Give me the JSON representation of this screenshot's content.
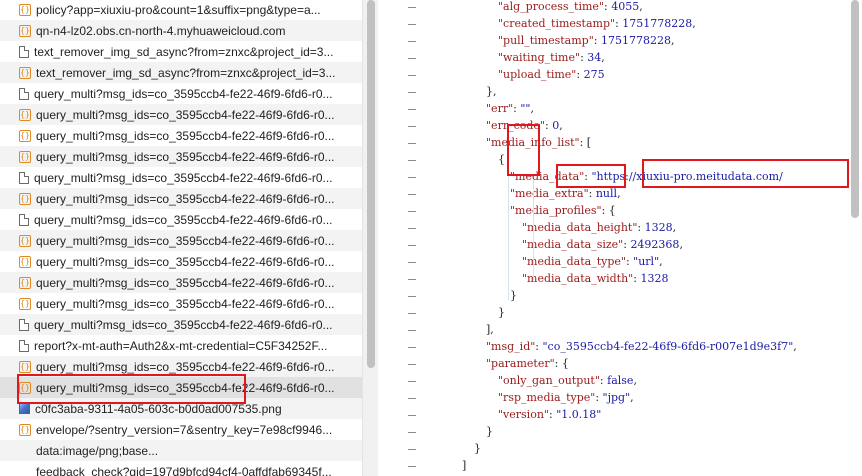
{
  "requests": [
    {
      "icon": "xhr",
      "name": "policy?app=xiuxiu-pro&count=1&suffix=png&type=a..."
    },
    {
      "icon": "xhr",
      "name": "qn-n4-lz02.obs.cn-north-4.myhuaweicloud.com"
    },
    {
      "icon": "doc",
      "name": "text_remover_img_sd_async?from=znxc&project_id=3..."
    },
    {
      "icon": "xhr",
      "name": "text_remover_img_sd_async?from=znxc&project_id=3..."
    },
    {
      "icon": "doc",
      "name": "query_multi?msg_ids=co_3595ccb4-fe22-46f9-6fd6-r0..."
    },
    {
      "icon": "xhr",
      "name": "query_multi?msg_ids=co_3595ccb4-fe22-46f9-6fd6-r0..."
    },
    {
      "icon": "xhr",
      "name": "query_multi?msg_ids=co_3595ccb4-fe22-46f9-6fd6-r0..."
    },
    {
      "icon": "xhr",
      "name": "query_multi?msg_ids=co_3595ccb4-fe22-46f9-6fd6-r0..."
    },
    {
      "icon": "doc",
      "name": "query_multi?msg_ids=co_3595ccb4-fe22-46f9-6fd6-r0..."
    },
    {
      "icon": "xhr",
      "name": "query_multi?msg_ids=co_3595ccb4-fe22-46f9-6fd6-r0..."
    },
    {
      "icon": "doc",
      "name": "query_multi?msg_ids=co_3595ccb4-fe22-46f9-6fd6-r0..."
    },
    {
      "icon": "xhr",
      "name": "query_multi?msg_ids=co_3595ccb4-fe22-46f9-6fd6-r0..."
    },
    {
      "icon": "xhr",
      "name": "query_multi?msg_ids=co_3595ccb4-fe22-46f9-6fd6-r0..."
    },
    {
      "icon": "xhr",
      "name": "query_multi?msg_ids=co_3595ccb4-fe22-46f9-6fd6-r0..."
    },
    {
      "icon": "xhr",
      "name": "query_multi?msg_ids=co_3595ccb4-fe22-46f9-6fd6-r0..."
    },
    {
      "icon": "doc",
      "name": "query_multi?msg_ids=co_3595ccb4-fe22-46f9-6fd6-r0..."
    },
    {
      "icon": "doc",
      "name": "report?x-mt-auth=Auth2&x-mt-credential=C5F34252F..."
    },
    {
      "icon": "xhr",
      "name": "query_multi?msg_ids=co_3595ccb4-fe22-46f9-6fd6-r0..."
    },
    {
      "icon": "xhr",
      "name": "query_multi?msg_ids=co_3595ccb4-fe22-46f9-6fd6-r0...",
      "selected": true
    },
    {
      "icon": "img",
      "name": "c0fc3aba-9311-4a05-603c-b0d0ad007535.png"
    },
    {
      "icon": "xhr",
      "name": "envelope/?sentry_version=7&sentry_key=7e98cf9946..."
    },
    {
      "icon": "blank",
      "name": "data:image/png;base..."
    },
    {
      "icon": "blank",
      "name": "feedback_check?gid=197d9bfcd94cf4-0affdfab69345f..."
    }
  ],
  "json_lines": [
    {
      "indent": 7,
      "parts": [
        [
          "k",
          "\"alg_process_time\""
        ],
        [
          "p",
          ": "
        ],
        [
          "n",
          "4055"
        ],
        [
          "p",
          ","
        ]
      ]
    },
    {
      "indent": 7,
      "parts": [
        [
          "k",
          "\"created_timestamp\""
        ],
        [
          "p",
          ": "
        ],
        [
          "n",
          "1751778228"
        ],
        [
          "p",
          ","
        ]
      ]
    },
    {
      "indent": 7,
      "parts": [
        [
          "k",
          "\"pull_timestamp\""
        ],
        [
          "p",
          ": "
        ],
        [
          "n",
          "1751778228"
        ],
        [
          "p",
          ","
        ]
      ]
    },
    {
      "indent": 7,
      "parts": [
        [
          "k",
          "\"waiting_time\""
        ],
        [
          "p",
          ": "
        ],
        [
          "n",
          "34"
        ],
        [
          "p",
          ","
        ]
      ]
    },
    {
      "indent": 7,
      "parts": [
        [
          "k",
          "\"upload_time\""
        ],
        [
          "p",
          ": "
        ],
        [
          "n",
          "275"
        ]
      ]
    },
    {
      "indent": 6,
      "parts": [
        [
          "p",
          "},"
        ]
      ]
    },
    {
      "indent": 6,
      "parts": [
        [
          "k",
          "\"err\""
        ],
        [
          "p",
          ": "
        ],
        [
          "s",
          "\"\""
        ],
        [
          "p",
          ","
        ]
      ]
    },
    {
      "indent": 6,
      "parts": [
        [
          "k",
          "\"err_code\""
        ],
        [
          "p",
          ": "
        ],
        [
          "n",
          "0"
        ],
        [
          "p",
          ","
        ]
      ]
    },
    {
      "indent": 6,
      "parts": [
        [
          "k",
          "\"media_info_list\""
        ],
        [
          "p",
          ": ["
        ]
      ]
    },
    {
      "indent": 7,
      "parts": [
        [
          "p",
          "{"
        ]
      ]
    },
    {
      "indent": 8,
      "parts": [
        [
          "k",
          "\"media_data\""
        ],
        [
          "p",
          ": "
        ],
        [
          "s",
          "\"https://xiuxiu-pro.meitudata.com/"
        ]
      ]
    },
    {
      "indent": 8,
      "parts": [
        [
          "k",
          "\"media_extra\""
        ],
        [
          "p",
          ": "
        ],
        [
          "n",
          "null"
        ],
        [
          "p",
          ","
        ]
      ]
    },
    {
      "indent": 8,
      "parts": [
        [
          "k",
          "\"media_profiles\""
        ],
        [
          "p",
          ": {"
        ]
      ]
    },
    {
      "indent": 9,
      "parts": [
        [
          "k",
          "\"media_data_height\""
        ],
        [
          "p",
          ": "
        ],
        [
          "n",
          "1328"
        ],
        [
          "p",
          ","
        ]
      ]
    },
    {
      "indent": 9,
      "parts": [
        [
          "k",
          "\"media_data_size\""
        ],
        [
          "p",
          ": "
        ],
        [
          "n",
          "2492368"
        ],
        [
          "p",
          ","
        ]
      ]
    },
    {
      "indent": 9,
      "parts": [
        [
          "k",
          "\"media_data_type\""
        ],
        [
          "p",
          ": "
        ],
        [
          "s",
          "\"url\""
        ],
        [
          "p",
          ","
        ]
      ]
    },
    {
      "indent": 9,
      "parts": [
        [
          "k",
          "\"media_data_width\""
        ],
        [
          "p",
          ": "
        ],
        [
          "n",
          "1328"
        ]
      ]
    },
    {
      "indent": 8,
      "parts": [
        [
          "p",
          "}"
        ]
      ]
    },
    {
      "indent": 7,
      "parts": [
        [
          "p",
          "}"
        ]
      ]
    },
    {
      "indent": 6,
      "parts": [
        [
          "p",
          "],"
        ]
      ]
    },
    {
      "indent": 6,
      "parts": [
        [
          "k",
          "\"msg_id\""
        ],
        [
          "p",
          ": "
        ],
        [
          "s",
          "\"co_3595ccb4-fe22-46f9-6fd6-r007e1d9e3f7\""
        ],
        [
          "p",
          ","
        ]
      ]
    },
    {
      "indent": 6,
      "parts": [
        [
          "k",
          "\"parameter\""
        ],
        [
          "p",
          ": {"
        ]
      ]
    },
    {
      "indent": 7,
      "parts": [
        [
          "k",
          "\"only_gan_output\""
        ],
        [
          "p",
          ": "
        ],
        [
          "n",
          "false"
        ],
        [
          "p",
          ","
        ]
      ]
    },
    {
      "indent": 7,
      "parts": [
        [
          "k",
          "\"rsp_media_type\""
        ],
        [
          "p",
          ": "
        ],
        [
          "s",
          "\"jpg\""
        ],
        [
          "p",
          ","
        ]
      ]
    },
    {
      "indent": 7,
      "parts": [
        [
          "k",
          "\"version\""
        ],
        [
          "p",
          ": "
        ],
        [
          "s",
          "\"1.0.18\""
        ]
      ]
    },
    {
      "indent": 6,
      "parts": [
        [
          "p",
          "}"
        ]
      ]
    },
    {
      "indent": 5,
      "parts": [
        [
          "p",
          "}"
        ]
      ]
    },
    {
      "indent": 4,
      "parts": [
        [
          "p",
          "]"
        ]
      ]
    },
    {
      "indent": 3,
      "parts": [
        [
          "p",
          "}"
        ]
      ]
    }
  ],
  "colors": {
    "annotation": "#e0181e",
    "json_key": "#9a1a1a",
    "json_value": "#1a1aa6",
    "selected_row": "#e1e1e1",
    "xhr_icon": "#e08a23"
  },
  "icons": {
    "xhr": "braces-icon",
    "doc": "document-icon",
    "img": "image-thumbnail-icon",
    "blank": "blank-icon"
  }
}
